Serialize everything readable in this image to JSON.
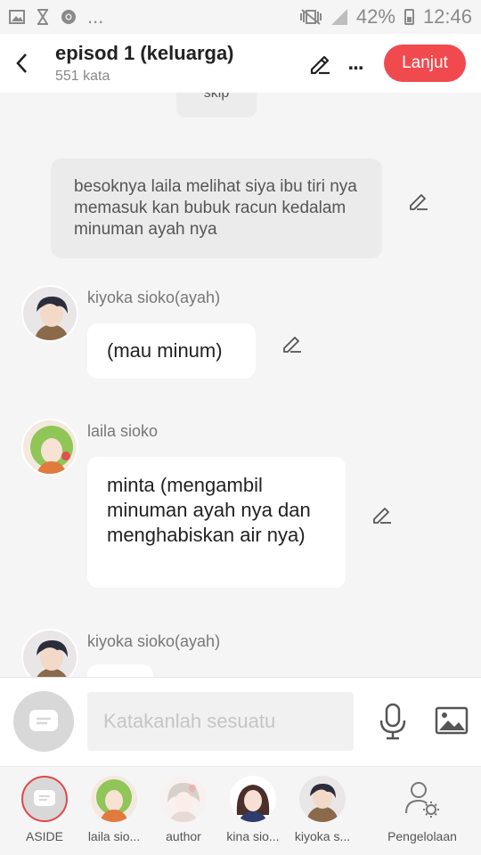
{
  "status_bar": {
    "battery": "42%",
    "time": "12:46",
    "dots": "..."
  },
  "header": {
    "title": "episod 1 (keluarga)",
    "word_count": "551 kata",
    "more_label": "...",
    "continue_label": "Lanjut",
    "accent": "#f04a4f"
  },
  "chat": {
    "skip_label": "skip",
    "narration": "besoknya laila melihat siya ibu tiri nya memasuk kan bubuk racun kedalam minuman ayah nya",
    "messages": [
      {
        "speaker": "kiyoka sioko(ayah)",
        "text": "(mau minum)"
      },
      {
        "speaker": "laila sioko",
        "text": "minta (mengambil minuman ayah nya dan menghabiskan air nya)"
      },
      {
        "speaker": "kiyoka sioko(ayah)",
        "text": ""
      }
    ]
  },
  "input": {
    "placeholder": "Katakanlah sesuatu"
  },
  "characters": [
    {
      "label": "ASIDE"
    },
    {
      "label": "laila sio..."
    },
    {
      "label": "author"
    },
    {
      "label": "kina sio..."
    },
    {
      "label": "kiyoka s..."
    },
    {
      "label": "Pengelolaan"
    }
  ]
}
